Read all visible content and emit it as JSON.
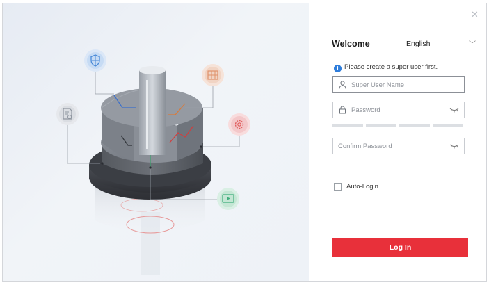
{
  "window": {
    "minimize_symbol": "–",
    "close_symbol": "✕"
  },
  "login": {
    "welcome": "Welcome",
    "language": "English",
    "notice": "Please create a super user first.",
    "username_placeholder": "Super User Name",
    "password_placeholder": "Password",
    "confirm_placeholder": "Confirm Password",
    "auto_login_label": "Auto-Login",
    "auto_login_checked": false,
    "login_button": "Log In",
    "password_strength_segments": 4
  },
  "colors": {
    "primary_red": "#e8303a",
    "info_blue": "#2e7ddb",
    "icon_blue": "#4a8ad8",
    "icon_orange": "#e0926a",
    "icon_red": "#e05a5a",
    "icon_green": "#3fae7c",
    "icon_gray": "#8f96a0"
  },
  "illustration_icons": [
    "shield-icon",
    "grid-icon",
    "gear-icon",
    "video-icon",
    "document-search-icon"
  ]
}
